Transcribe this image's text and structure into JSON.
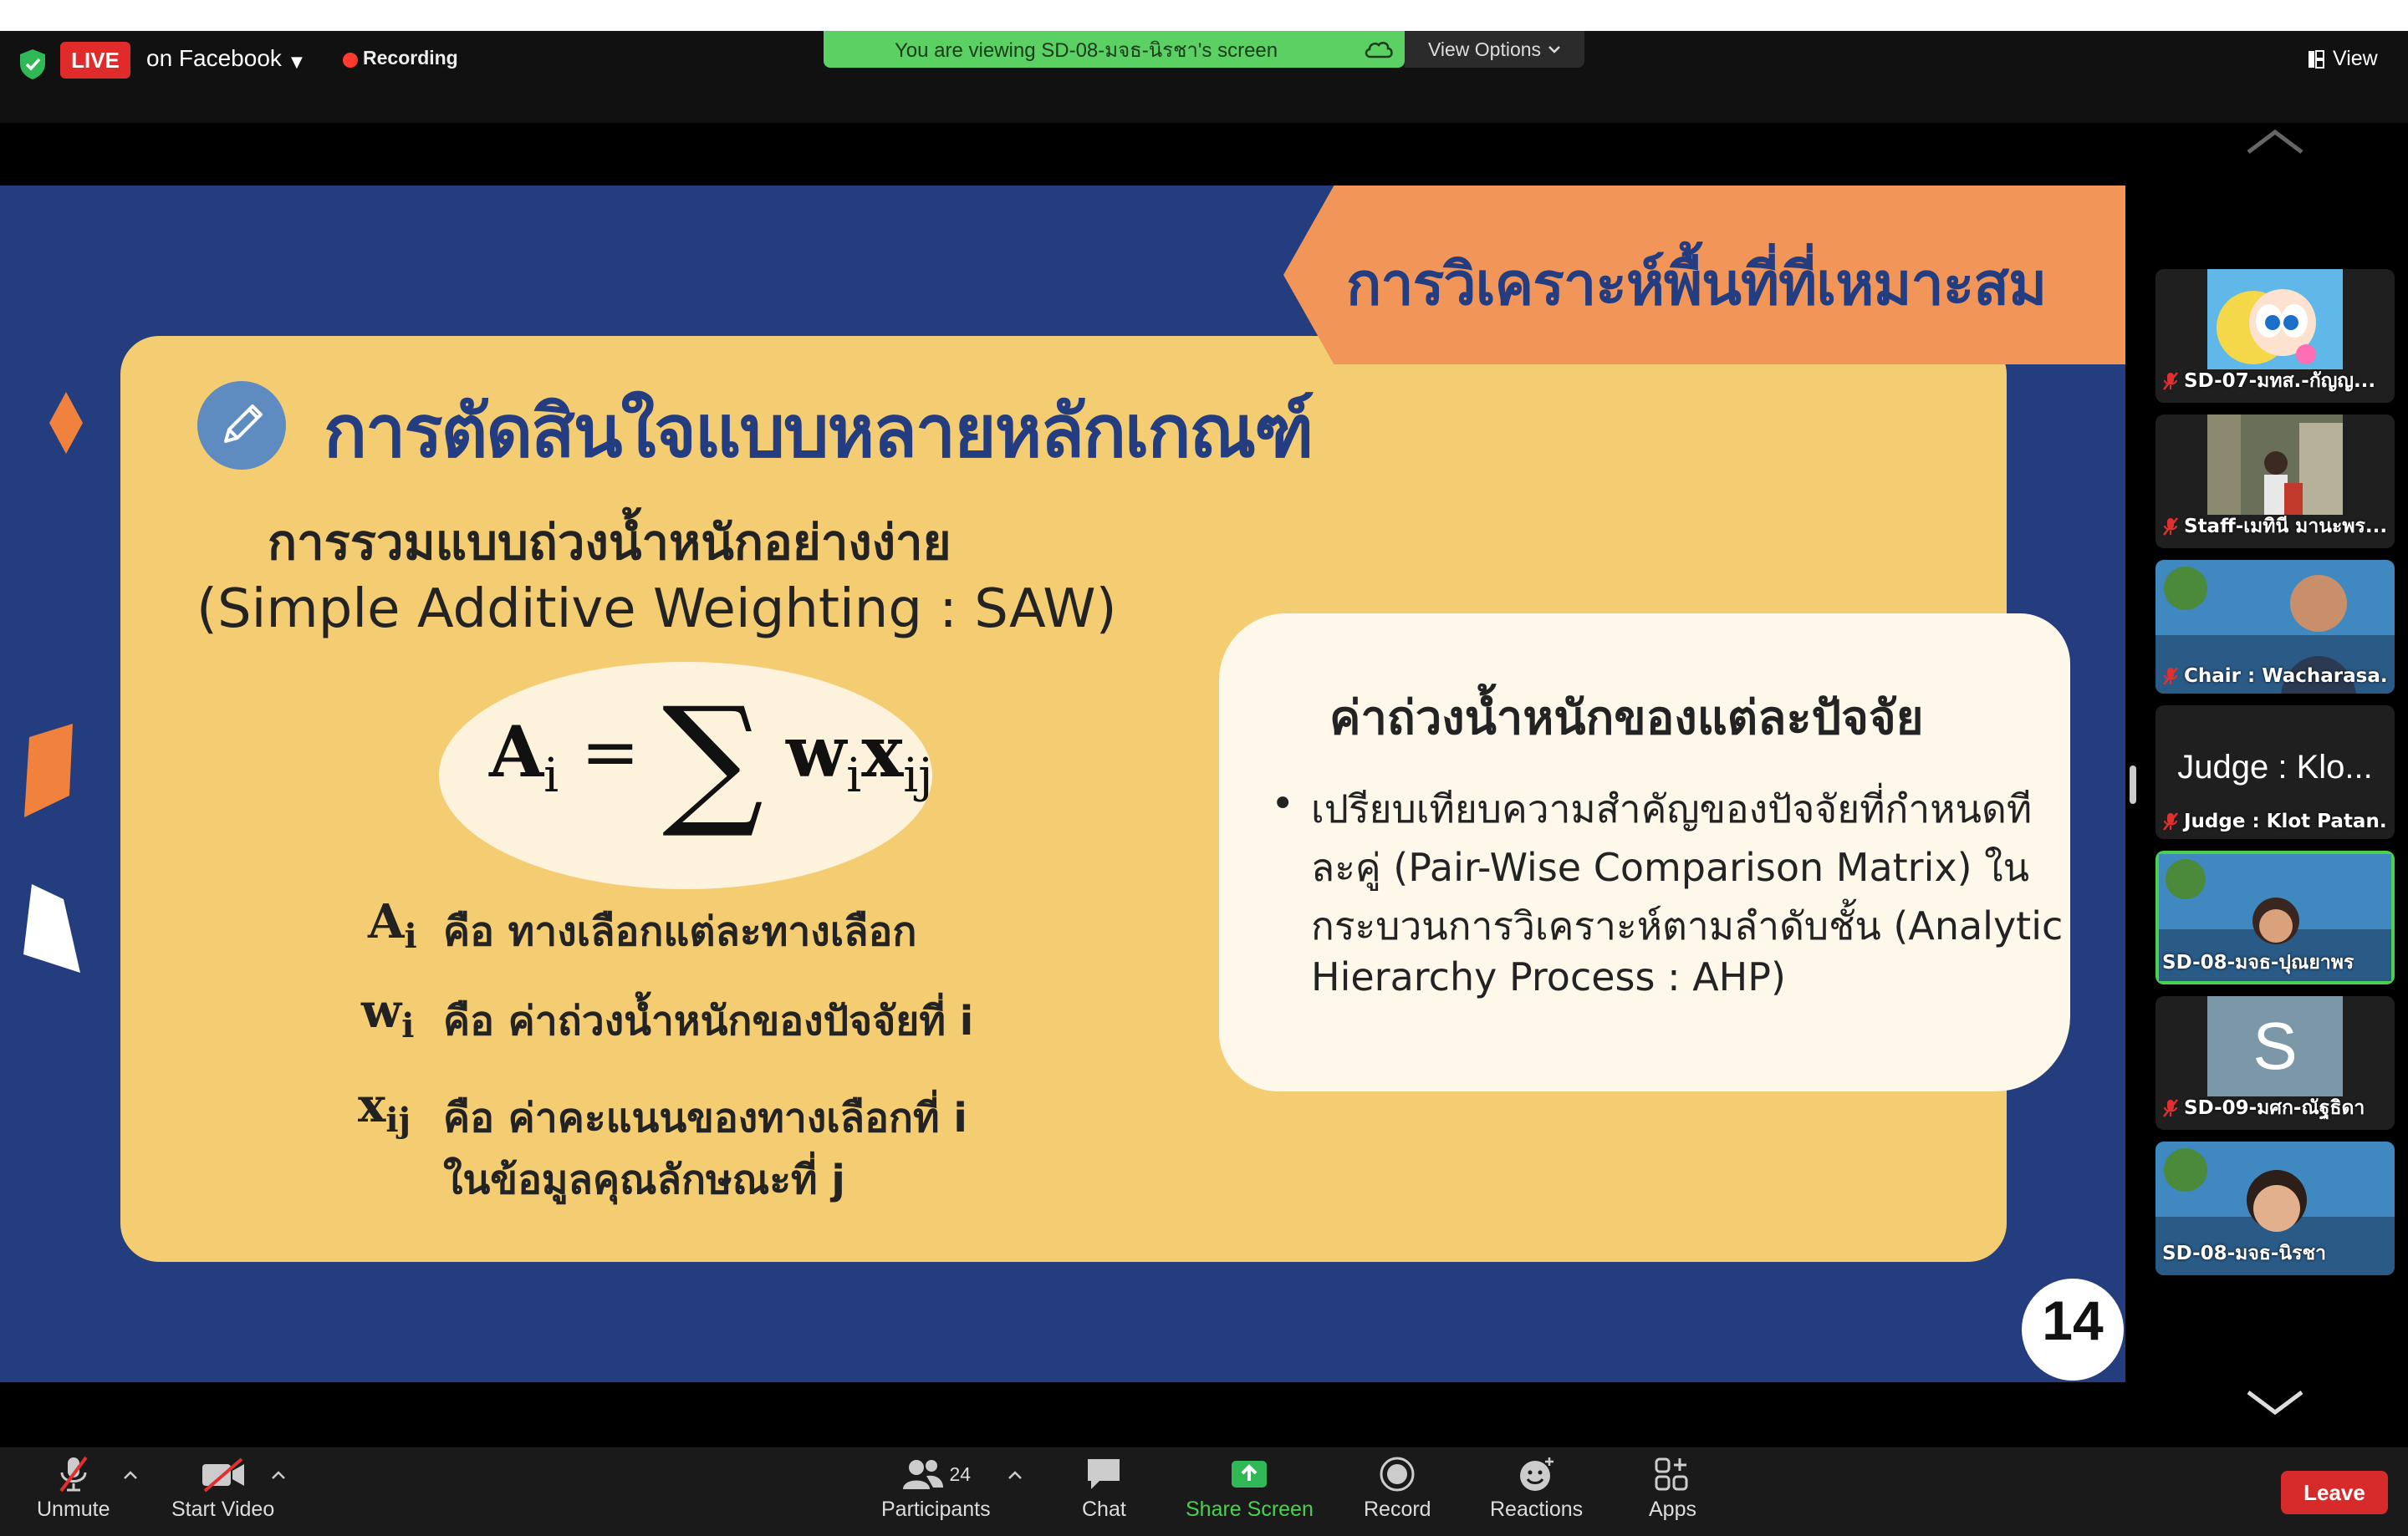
{
  "topbar": {
    "live_label": "LIVE",
    "live_destination": "on Facebook",
    "recording_label": "Recording",
    "viewing_banner": "You are viewing SD-08-มจธ-นิรชา's screen",
    "view_options_label": "View Options",
    "view_label": "View"
  },
  "slide": {
    "title": "การวิเคราะห์พื้นที่ที่เหมาะสม",
    "main_heading": "การตัดสินใจแบบหลายหลักเกณฑ์",
    "sub_heading": "การรวมแบบถ่วงน้ำหนักอย่างง่าย",
    "sub_heading_en": "(Simple Additive Weighting : SAW)",
    "definitions": [
      {
        "symbol": "A",
        "sub": "i",
        "text": "คือ  ทางเลือกแต่ละทางเลือก"
      },
      {
        "symbol": "w",
        "sub": "i",
        "text": "คือ  ค่าถ่วงน้ำหนักของปัจจัยที่ i"
      },
      {
        "symbol": "x",
        "sub": "ij",
        "text": "คือ ค่าคะแนนของทางเลือกที่ i",
        "text2": "ในข้อมูลคุณลักษณะที่ j"
      }
    ],
    "right_card": {
      "title": "ค่าถ่วงน้ำหนักของแต่ละปัจจัย",
      "lines": [
        "เปรียบเทียบความสำคัญของปัจจัยที่กำหนดที",
        "ละคู่ (Pair-Wise Comparison Matrix) ใน",
        "กระบวนการวิเคราะห์ตามลำดับชั้น (Analytic",
        "Hierarchy Process : AHP)"
      ]
    },
    "page_number": "14"
  },
  "participants": [
    {
      "name": "SD-07-มทส.-กัญญ...",
      "muted": true
    },
    {
      "name": "Staff-เมทินี มานะพร...",
      "muted": true
    },
    {
      "name": "Chair : Wacharasa...",
      "muted": true
    },
    {
      "name": "Judge : Klot Patan...",
      "muted": true,
      "display": "Judge : Klo..."
    },
    {
      "name": "SD-08-มจธ-ปุณยาพร",
      "muted": false
    },
    {
      "name": "SD-09-มศก-ณัฐธิดา",
      "muted": true,
      "initial": "S"
    },
    {
      "name": "SD-08-มจธ-นิรชา",
      "muted": false
    }
  ],
  "toolbar": {
    "unmute": "Unmute",
    "start_video": "Start Video",
    "participants": "Participants",
    "participant_count": "24",
    "chat": "Chat",
    "share_screen": "Share Screen",
    "record": "Record",
    "reactions": "Reactions",
    "apps": "Apps",
    "leave": "Leave"
  },
  "colors": {
    "slide_bg": "#243d7f",
    "card": "#f4cd73",
    "title_tab": "#f29558",
    "banner_green": "#5bd163",
    "leave_red": "#d72b2b",
    "share_green": "#4bd14f"
  }
}
